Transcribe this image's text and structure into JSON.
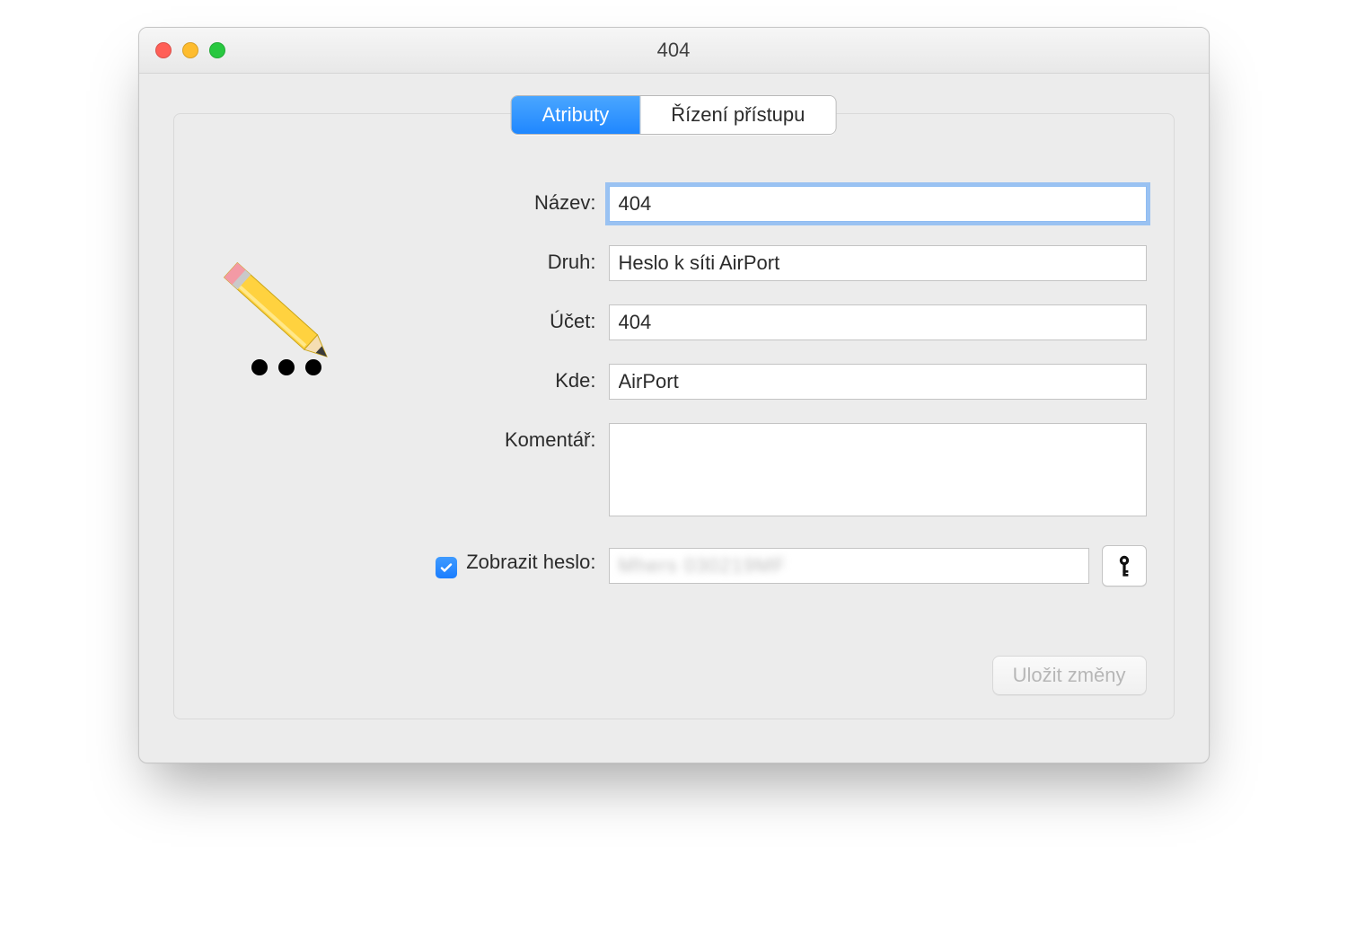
{
  "window": {
    "title": "404"
  },
  "tabs": {
    "active": "Atributy",
    "inactive": "Řízení přístupu"
  },
  "labels": {
    "name": "Název:",
    "kind": "Druh:",
    "account": "Účet:",
    "where": "Kde:",
    "comment": "Komentář:",
    "show_password": "Zobrazit heslo:"
  },
  "values": {
    "name": "404",
    "kind": "Heslo k síti AirPort",
    "account": "404",
    "where": "AirPort",
    "comment": "",
    "password": "Mhers 030219MF"
  },
  "buttons": {
    "save": "Uložit změny"
  },
  "state": {
    "show_password_checked": true
  }
}
